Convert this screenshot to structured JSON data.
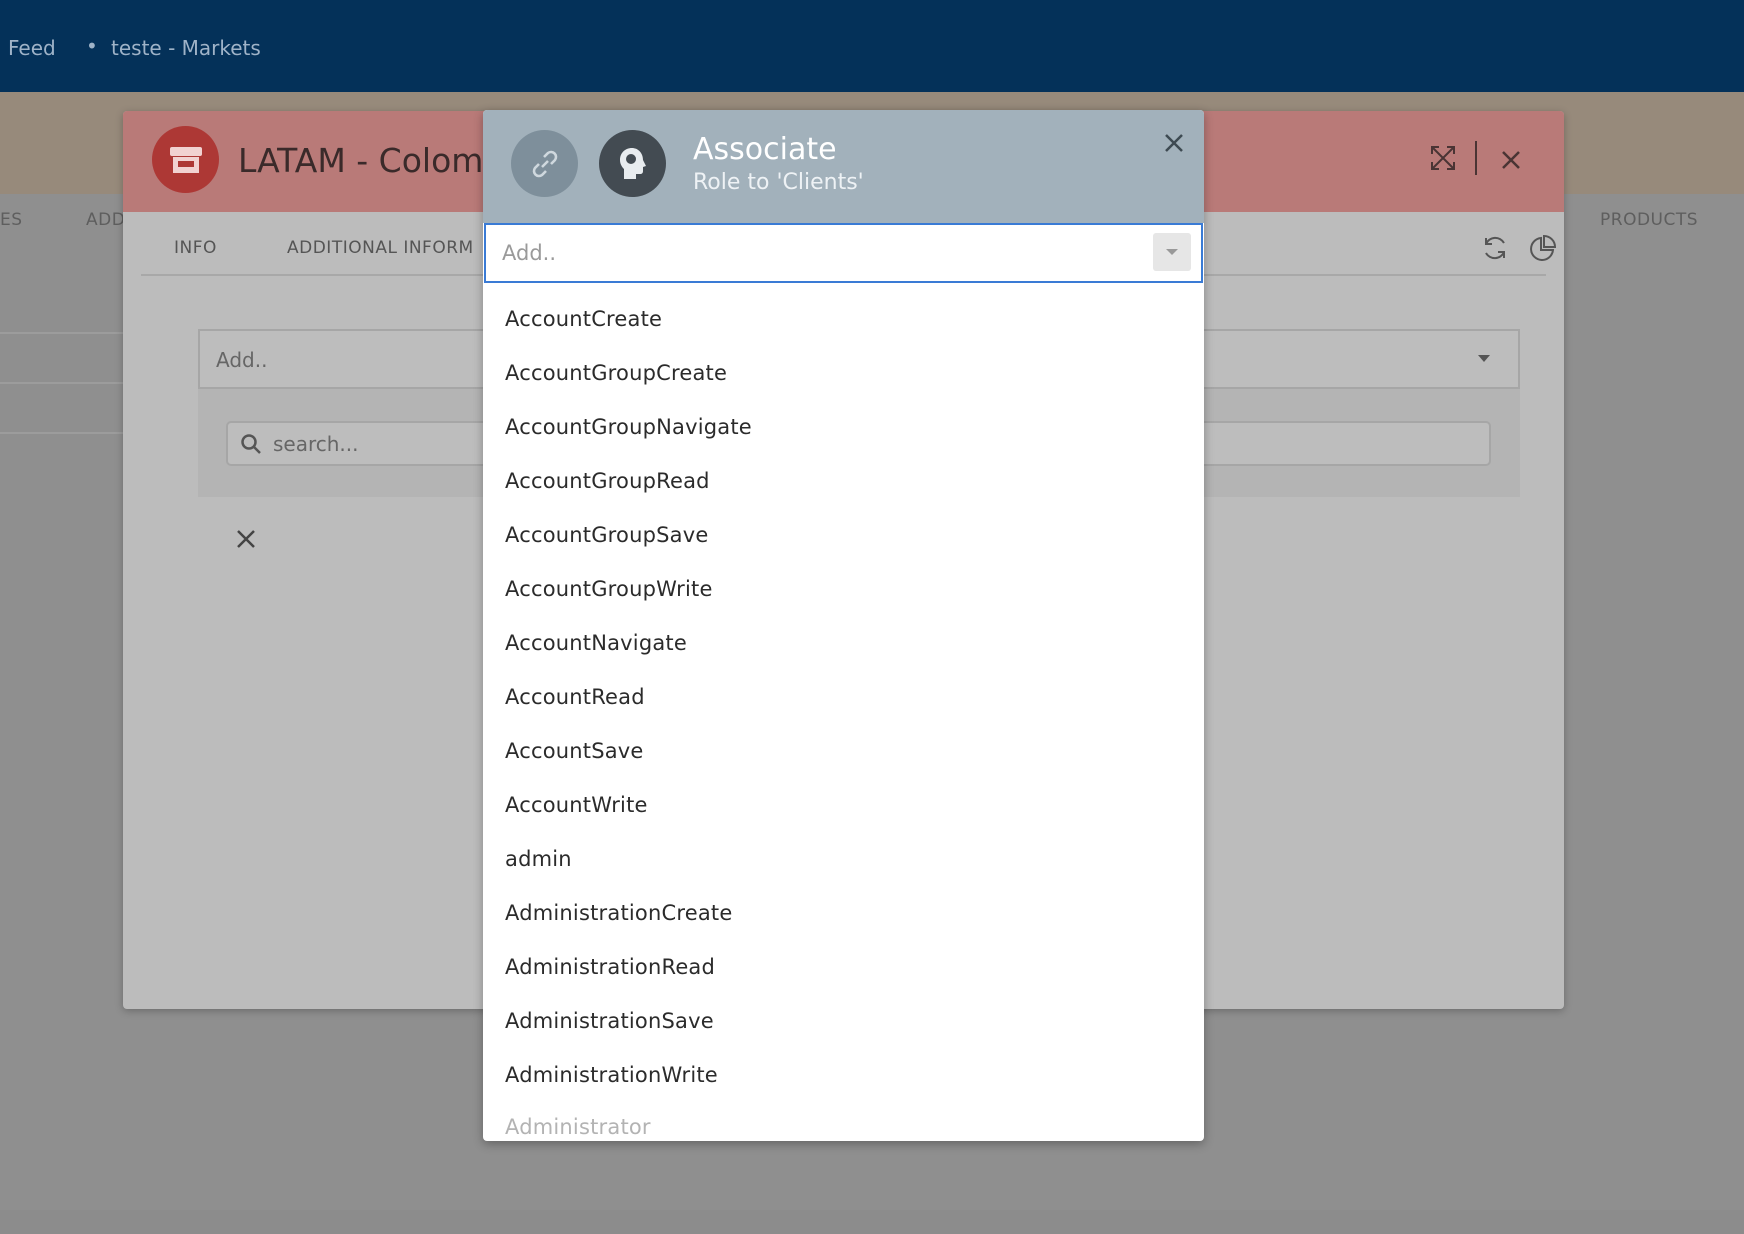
{
  "topbar": {
    "feed_label": "Feed",
    "separator": "•",
    "market_label": "teste - Markets"
  },
  "background": {
    "tab_left_fragment": "ES",
    "tab_left_fragment2": "ADD",
    "tab_right": "PRODUCTS"
  },
  "window": {
    "title": "LATAM - Colomb",
    "tabs": [
      "INFO",
      "ADDITIONAL INFORM"
    ],
    "select_placeholder": "Add..",
    "search_placeholder": "search..."
  },
  "modal": {
    "title": "Associate",
    "subtitle": "Role to 'Clients'",
    "input_placeholder": "Add..",
    "options": [
      "AccountCreate",
      "AccountGroupCreate",
      "AccountGroupNavigate",
      "AccountGroupRead",
      "AccountGroupSave",
      "AccountGroupWrite",
      "AccountNavigate",
      "AccountRead",
      "AccountSave",
      "AccountWrite",
      "admin",
      "AdministrationCreate",
      "AdministrationRead",
      "AdministrationSave",
      "AdministrationWrite",
      "Administrator"
    ]
  },
  "colors": {
    "topbar": "#043159",
    "window_header": "#b97a78",
    "modal_header": "#a2b1bb",
    "input_focus": "#3a7bd5"
  }
}
